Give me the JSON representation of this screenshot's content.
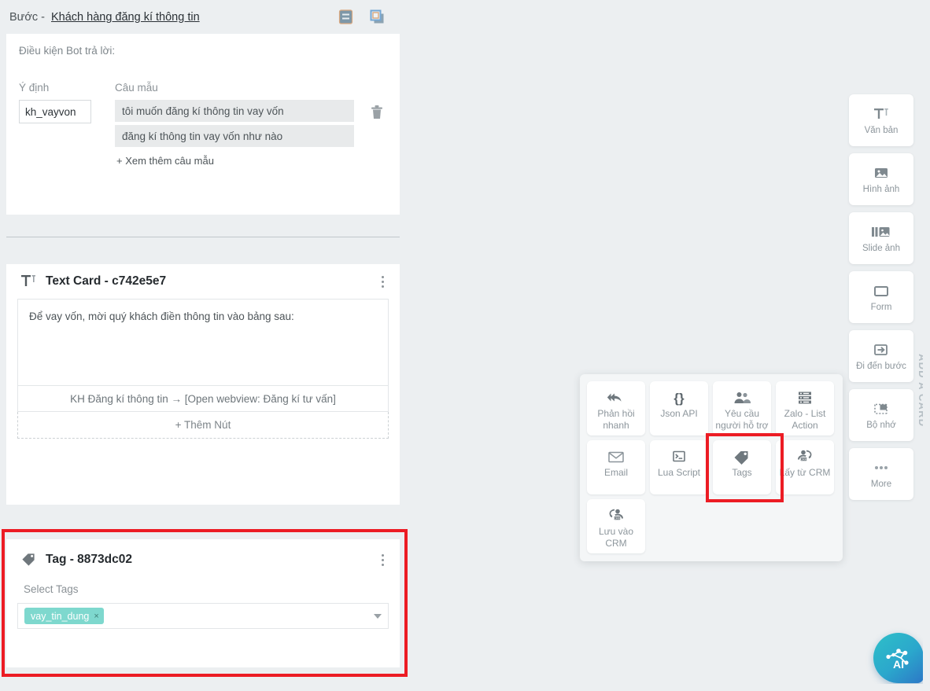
{
  "header": {
    "step_prefix": "Bước -",
    "step_name": "Khách hàng đăng kí thông tin",
    "icons": [
      {
        "name": "list-view-icon",
        "label": "list-view"
      },
      {
        "name": "duplicate-icon",
        "label": "duplicate"
      }
    ]
  },
  "condition_panel": {
    "title": "Điều kiện Bot trả lời:",
    "col_intent": "Ý định",
    "col_sample": "Câu mẫu",
    "intent_value": "kh_vayvon",
    "intent_placeholder": "Ý định",
    "samples": [
      "tôi muốn đăng kí thông tin vay vốn",
      "đăng kí thông tin vay vốn như nào"
    ],
    "more_samples": "+ Xem thêm câu mẫu",
    "delete_icon": "trash-icon"
  },
  "text_card": {
    "icon": "text-format-icon",
    "title": "Text Card - c742e5e7",
    "message": "Để vay vốn, mời quý khách điền thông tin vào bảng sau:",
    "button_row": "KH Đăng kí thông tin → [Open webview: Đăng kí tư vấn]",
    "add_button": "+ Thêm Nút",
    "menu_icon": "kebab-menu-icon"
  },
  "tag_card": {
    "icon": "tag-icon",
    "title": "Tag - 8873dc02",
    "select_label": "Select Tags",
    "chips": [
      {
        "text": "vay_tin_dung",
        "remove": "×",
        "color": "#7ed8ce"
      }
    ],
    "menu_icon": "kebab-menu-icon",
    "highlight_color": "#ec1c24"
  },
  "add_card_rail": {
    "label": "ADD A CARD",
    "items": [
      {
        "label": "Văn bản",
        "icon": "text-format-icon"
      },
      {
        "label": "Hình ảnh",
        "icon": "image-icon"
      },
      {
        "label": "Slide ảnh",
        "icon": "image-slider-icon"
      },
      {
        "label": "Form",
        "icon": "form-rectangle-icon"
      },
      {
        "label": "Đi đến bước",
        "icon": "goto-step-arrow-icon"
      },
      {
        "label": "Bộ nhớ",
        "icon": "memory-dashed-icon"
      },
      {
        "label": "More",
        "icon": "ellipsis-icon"
      }
    ]
  },
  "card_picker_popup": {
    "items": [
      {
        "label": "Phản hồi nhanh",
        "icon": "quick-reply-icon",
        "selected": false
      },
      {
        "label": "Json API",
        "icon": "json-braces-icon",
        "selected": false
      },
      {
        "label": "Yêu cầu người hỗ trợ",
        "icon": "people-icon",
        "selected": false
      },
      {
        "label": "Zalo - List Action",
        "icon": "server-list-icon",
        "selected": false
      },
      {
        "label": "Email",
        "icon": "envelope-icon",
        "selected": false
      },
      {
        "label": "Lua Script",
        "icon": "terminal-icon",
        "selected": false
      },
      {
        "label": "Tags",
        "icon": "tag-icon",
        "selected": true
      },
      {
        "label": "Lấy từ CRM",
        "icon": "crm-fetch-icon",
        "selected": false
      },
      {
        "label": "Lưu vào CRM",
        "icon": "crm-save-icon",
        "selected": false
      }
    ],
    "highlight_color": "#ec1c24"
  },
  "ai_fab": {
    "icon": "ai-network-icon",
    "label": "AI",
    "gradient_from": "#2ec0c8",
    "gradient_to": "#2c77c6"
  }
}
